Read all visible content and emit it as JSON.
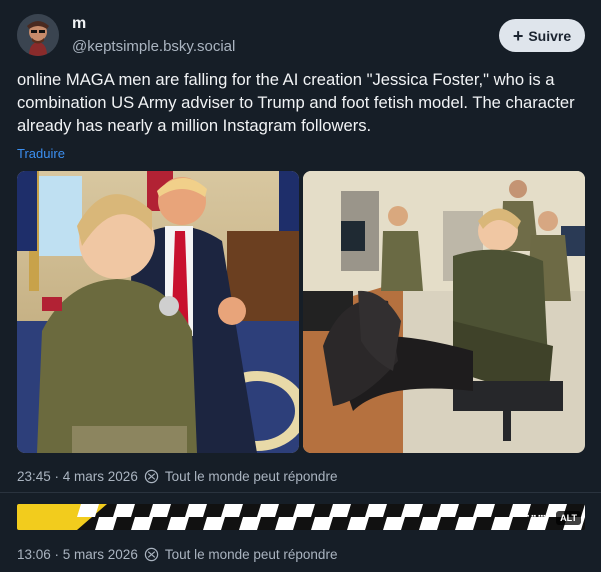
{
  "author": {
    "display_name": "m",
    "handle": "@keptsimple.bsky.social",
    "avatar_icon": "avatar-illustration"
  },
  "follow_button": {
    "label": "Suivre",
    "icon": "plus-icon"
  },
  "post": {
    "text": "online MAGA men are falling for the AI creation \"Jessica Foster,\" who is a combination US Army adviser to Trump and foot fetish model. The character already has nearly a million Instagram followers.",
    "translate_label": "Traduire",
    "timestamp": "23:45 · 4 mars 2026",
    "reply_setting": "Tout le monde peut répondre"
  },
  "second_post": {
    "timestamp": "13:06 · 5 mars 2026",
    "reply_setting": "Tout le monde peut répondre",
    "alt_badge": "ALT"
  },
  "colors": {
    "background": "#161e27",
    "link": "#3b8ff0",
    "muted": "#aab4c0",
    "checker_yellow": "#f2cc1d"
  }
}
